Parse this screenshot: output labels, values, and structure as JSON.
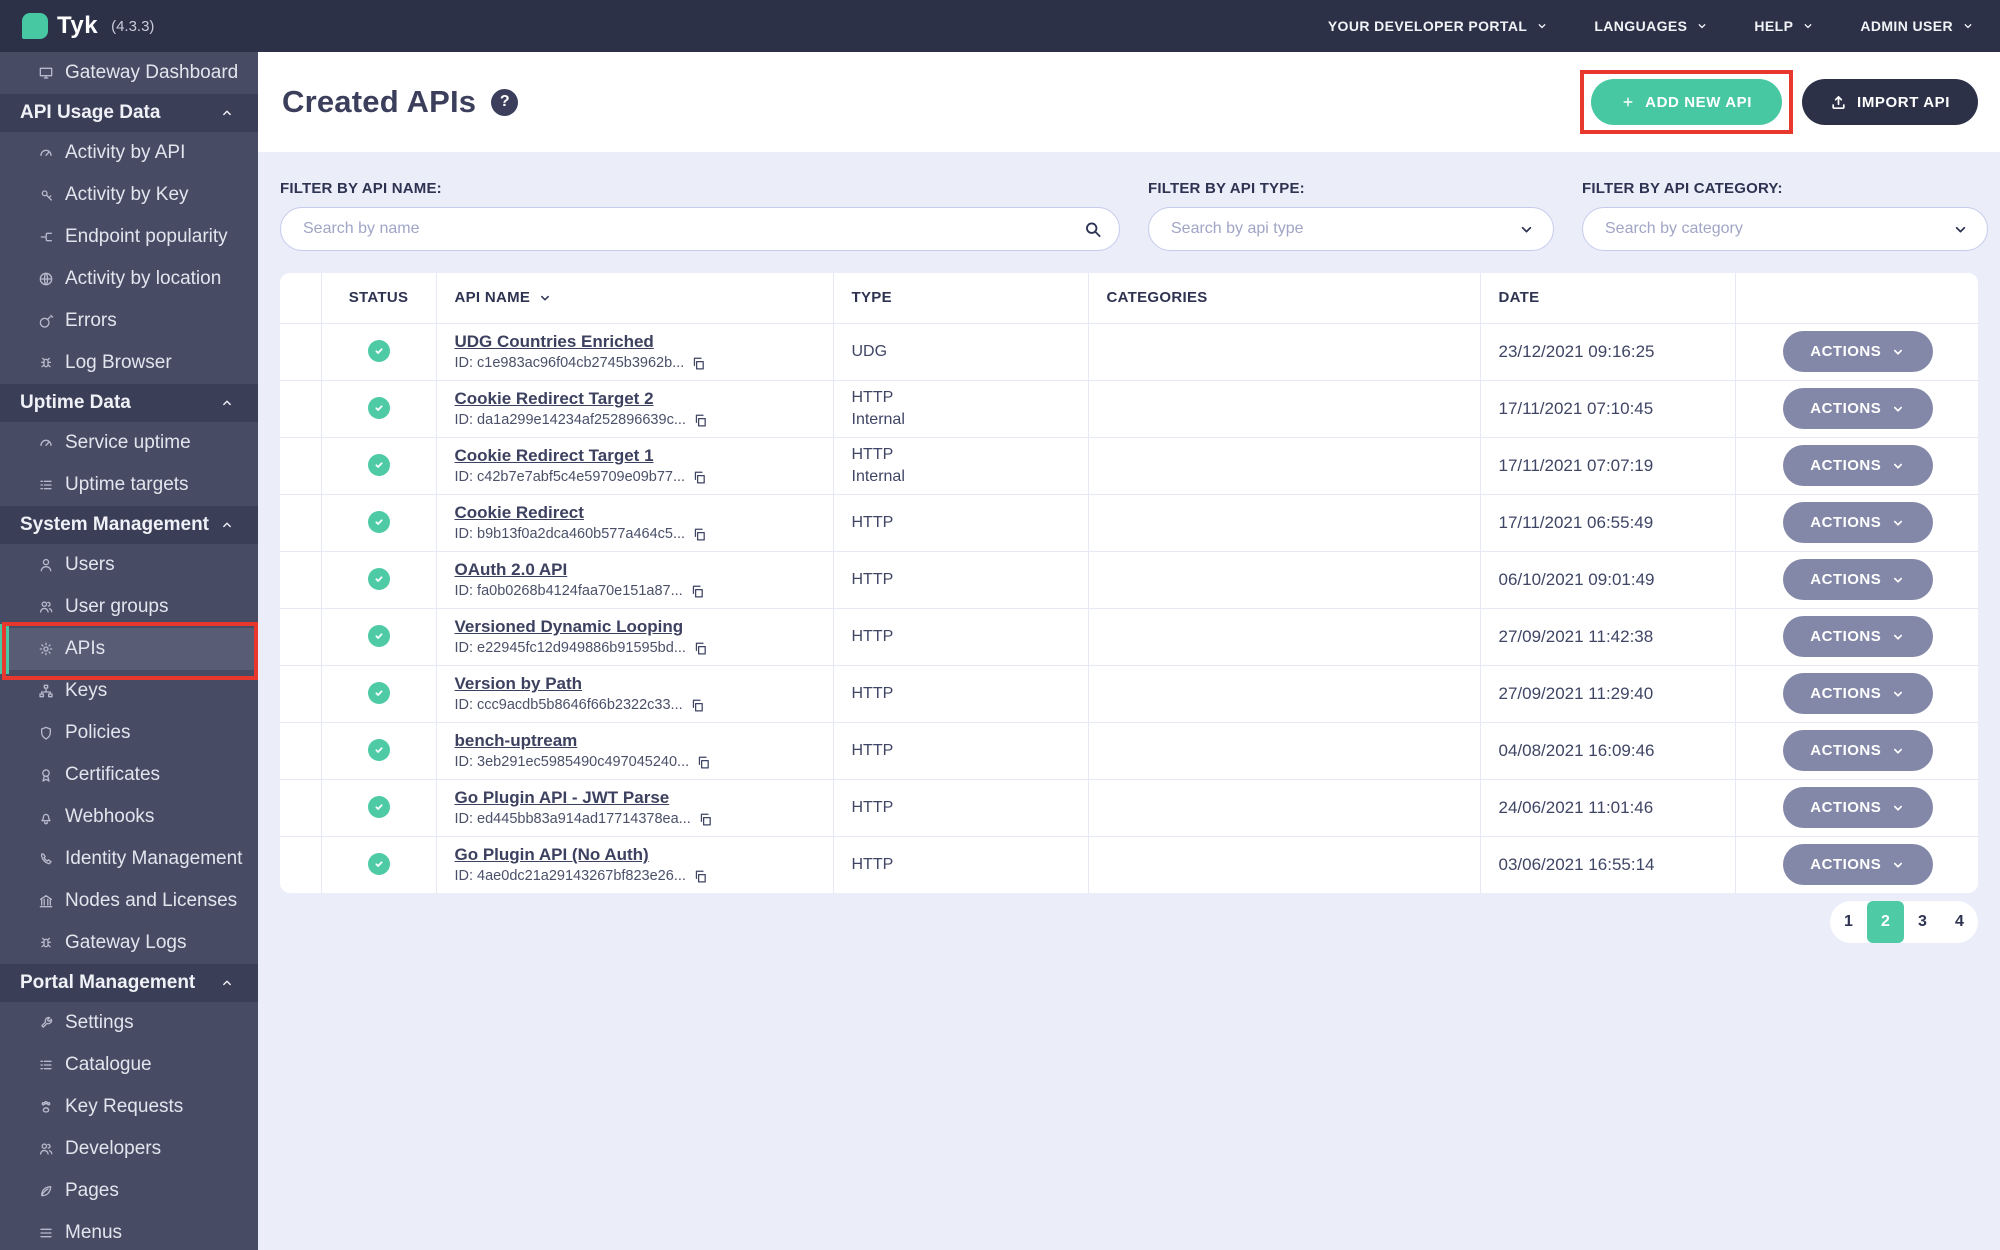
{
  "topbar": {
    "product": "Tyk",
    "version": "(4.3.3)",
    "menus": [
      {
        "label": "YOUR DEVELOPER PORTAL"
      },
      {
        "label": "LANGUAGES"
      },
      {
        "label": "HELP"
      },
      {
        "label": "ADMIN USER"
      }
    ]
  },
  "sidebar": {
    "top_item": {
      "label": "Gateway Dashboard",
      "icon": "monitor"
    },
    "sections": [
      {
        "label": "API Usage Data",
        "collapsed": false,
        "items": [
          {
            "label": "Activity by API",
            "icon": "gauge"
          },
          {
            "label": "Activity by Key",
            "icon": "key"
          },
          {
            "label": "Endpoint popularity",
            "icon": "share"
          },
          {
            "label": "Activity by location",
            "icon": "globe"
          },
          {
            "label": "Errors",
            "icon": "bomb"
          },
          {
            "label": "Log Browser",
            "icon": "bug"
          }
        ]
      },
      {
        "label": "Uptime Data",
        "collapsed": false,
        "items": [
          {
            "label": "Service uptime",
            "icon": "gauge"
          },
          {
            "label": "Uptime targets",
            "icon": "list"
          }
        ]
      },
      {
        "label": "System Management",
        "collapsed": false,
        "items": [
          {
            "label": "Users",
            "icon": "user"
          },
          {
            "label": "User groups",
            "icon": "users"
          },
          {
            "label": "APIs",
            "icon": "gears",
            "active": true,
            "highlighted": true
          },
          {
            "label": "Keys",
            "icon": "sitemap"
          },
          {
            "label": "Policies",
            "icon": "policy"
          },
          {
            "label": "Certificates",
            "icon": "certificate"
          },
          {
            "label": "Webhooks",
            "icon": "bell"
          },
          {
            "label": "Identity Management",
            "icon": "phone"
          },
          {
            "label": "Nodes and Licenses",
            "icon": "bank"
          },
          {
            "label": "Gateway Logs",
            "icon": "bug"
          }
        ]
      },
      {
        "label": "Portal Management",
        "collapsed": false,
        "items": [
          {
            "label": "Settings",
            "icon": "wrench"
          },
          {
            "label": "Catalogue",
            "icon": "list"
          },
          {
            "label": "Key Requests",
            "icon": "paw"
          },
          {
            "label": "Developers",
            "icon": "users"
          },
          {
            "label": "Pages",
            "icon": "leaf"
          },
          {
            "label": "Menus",
            "icon": "bars"
          }
        ]
      }
    ]
  },
  "page": {
    "title": "Created APIs",
    "help_badge": "?",
    "add_button_label": "ADD NEW API",
    "import_button_label": "IMPORT API"
  },
  "filters": [
    {
      "label": "FILTER BY API NAME:",
      "placeholder": "Search by name",
      "value": "",
      "control": "search"
    },
    {
      "label": "FILTER BY API TYPE:",
      "placeholder": "Search by api type",
      "value": "",
      "control": "select"
    },
    {
      "label": "FILTER BY API CATEGORY:",
      "placeholder": "Search by category",
      "value": "",
      "control": "select"
    }
  ],
  "table": {
    "columns": [
      "STATUS",
      "API NAME",
      "TYPE",
      "CATEGORIES",
      "DATE"
    ],
    "sorted_column": "API NAME",
    "actions_label": "ACTIONS",
    "rows": [
      {
        "status": "active",
        "name": "UDG Countries Enriched",
        "id": "ID: c1e983ac96f04cb2745b3962b...",
        "type_lines": [
          "UDG"
        ],
        "categories": "",
        "date": "23/12/2021 09:16:25"
      },
      {
        "status": "active",
        "name": "Cookie Redirect Target 2",
        "id": "ID: da1a299e14234af252896639c...",
        "type_lines": [
          "HTTP",
          "Internal"
        ],
        "categories": "",
        "date": "17/11/2021 07:10:45"
      },
      {
        "status": "active",
        "name": "Cookie Redirect Target 1",
        "id": "ID: c42b7e7abf5c4e59709e09b77...",
        "type_lines": [
          "HTTP",
          "Internal"
        ],
        "categories": "",
        "date": "17/11/2021 07:07:19"
      },
      {
        "status": "active",
        "name": "Cookie Redirect",
        "id": "ID: b9b13f0a2dca460b577a464c5...",
        "type_lines": [
          "HTTP"
        ],
        "categories": "",
        "date": "17/11/2021 06:55:49"
      },
      {
        "status": "active",
        "name": "OAuth 2.0 API",
        "id": "ID: fa0b0268b4124faa70e151a87...",
        "type_lines": [
          "HTTP"
        ],
        "categories": "",
        "date": "06/10/2021 09:01:49"
      },
      {
        "status": "active",
        "name": "Versioned Dynamic Looping",
        "id": "ID: e22945fc12d949886b91595bd...",
        "type_lines": [
          "HTTP"
        ],
        "categories": "",
        "date": "27/09/2021 11:42:38"
      },
      {
        "status": "active",
        "name": "Version by Path",
        "id": "ID: ccc9acdb5b8646f66b2322c33...",
        "type_lines": [
          "HTTP"
        ],
        "categories": "",
        "date": "27/09/2021 11:29:40"
      },
      {
        "status": "active",
        "name": "bench-uptream",
        "id": "ID: 3eb291ec5985490c497045240...",
        "type_lines": [
          "HTTP"
        ],
        "categories": "",
        "date": "04/08/2021 16:09:46"
      },
      {
        "status": "active",
        "name": "Go Plugin API - JWT Parse",
        "id": "ID: ed445bb83a914ad17714378ea...",
        "type_lines": [
          "HTTP"
        ],
        "categories": "",
        "date": "24/06/2021 11:01:46"
      },
      {
        "status": "active",
        "name": "Go Plugin API (No Auth)",
        "id": "ID: 4ae0dc21a29143267bf823e26...",
        "type_lines": [
          "HTTP"
        ],
        "categories": "",
        "date": "03/06/2021 16:55:14"
      }
    ]
  },
  "pagination": {
    "pages": [
      "1",
      "2",
      "3",
      "4"
    ],
    "active_page": "2"
  },
  "annotations": {
    "color": "#e8382d",
    "highlighted": [
      "sidebar-item-apis",
      "add-new-api-button"
    ]
  },
  "colors": {
    "accent_teal": "#47c8a2",
    "topbar_bg": "#2d3148",
    "sidebar_bg": "#474b63",
    "sidebar_section_bg": "#3a3e57",
    "status_ok": "#4ecba5",
    "actions_button": "#8488a8",
    "background": "#ebedf9",
    "annotation_red": "#e8382d"
  }
}
